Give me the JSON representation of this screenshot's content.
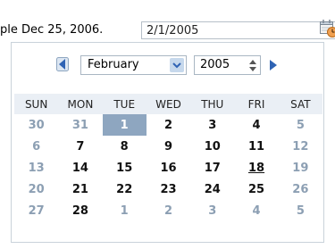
{
  "hint": {
    "text": "ple Dec 25, 2006."
  },
  "date_field": {
    "value": "2/1/2005"
  },
  "icons": {
    "calendar": "calendar-icon",
    "prev": "previous-month-icon",
    "next": "next-month-icon",
    "dropdown": "chevron-down-icon",
    "spinner_up": "spinner-up-icon",
    "spinner_down": "spinner-down-icon"
  },
  "colors": {
    "header_bg": "#eaeff5",
    "selected_bg": "#8ea6c0",
    "other_month_text": "#8c9fb3",
    "nav_arrow": "#2f63b4"
  },
  "calendar": {
    "month": "February",
    "year": "2005",
    "weekdays": [
      "SUN",
      "MON",
      "TUE",
      "WED",
      "THU",
      "FRI",
      "SAT"
    ],
    "weeks": [
      [
        {
          "d": "30",
          "o": true
        },
        {
          "d": "31",
          "o": true
        },
        {
          "d": "1",
          "s": true
        },
        {
          "d": "2"
        },
        {
          "d": "3"
        },
        {
          "d": "4"
        },
        {
          "d": "5",
          "o": true
        }
      ],
      [
        {
          "d": "6",
          "o": true
        },
        {
          "d": "7"
        },
        {
          "d": "8"
        },
        {
          "d": "9"
        },
        {
          "d": "10"
        },
        {
          "d": "11"
        },
        {
          "d": "12",
          "o": true
        }
      ],
      [
        {
          "d": "13",
          "o": true
        },
        {
          "d": "14"
        },
        {
          "d": "15"
        },
        {
          "d": "16"
        },
        {
          "d": "17"
        },
        {
          "d": "18",
          "t": true
        },
        {
          "d": "19",
          "o": true
        }
      ],
      [
        {
          "d": "20",
          "o": true
        },
        {
          "d": "21"
        },
        {
          "d": "22"
        },
        {
          "d": "23"
        },
        {
          "d": "24"
        },
        {
          "d": "25"
        },
        {
          "d": "26",
          "o": true
        }
      ],
      [
        {
          "d": "27",
          "o": true
        },
        {
          "d": "28"
        },
        {
          "d": "1",
          "o": true
        },
        {
          "d": "2",
          "o": true
        },
        {
          "d": "3",
          "o": true
        },
        {
          "d": "4",
          "o": true
        },
        {
          "d": "5",
          "o": true
        }
      ]
    ]
  }
}
